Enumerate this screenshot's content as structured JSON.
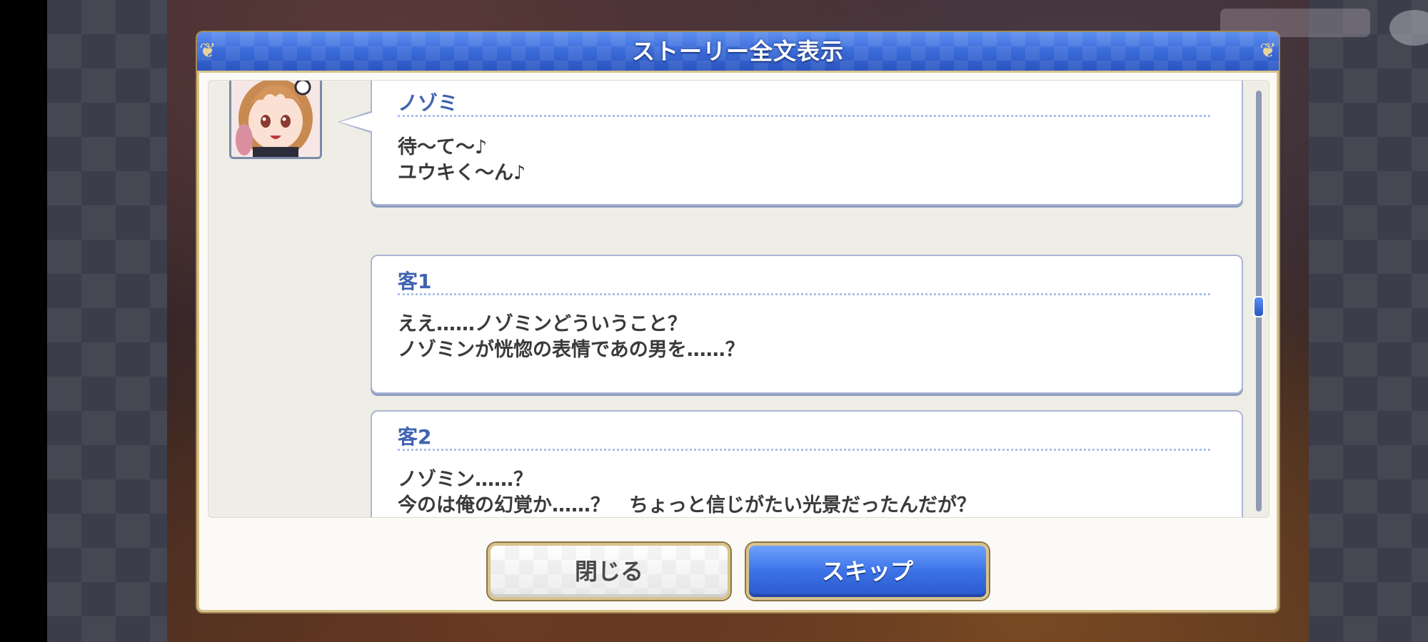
{
  "dialog": {
    "title": "ストーリー全文表示"
  },
  "log": [
    {
      "speaker": "ノゾミ",
      "lines": "待～て～♪\nユウキく～ん♪",
      "has_avatar": true
    },
    {
      "speaker": "客1",
      "lines": "ええ……ノゾミンどういうこと？\nノゾミンが恍惚の表情であの男を……？"
    },
    {
      "speaker": "客2",
      "lines": "ノゾミン……？\n今のは俺の幻覚か……？　ちょっと信じがたい光景だったんだが？"
    }
  ],
  "buttons": {
    "close_label": "閉じる",
    "skip_label": "スキップ"
  },
  "icons": {
    "avatar": "character-portrait",
    "corner": "gold-ornament-icon"
  },
  "scroll": {
    "position": 0.5
  },
  "colors": {
    "header_blue": "#3a6ad8",
    "gold_border": "#d9c28c",
    "speaker_blue": "#3f63b0",
    "skip_blue": "#3b72e6"
  }
}
